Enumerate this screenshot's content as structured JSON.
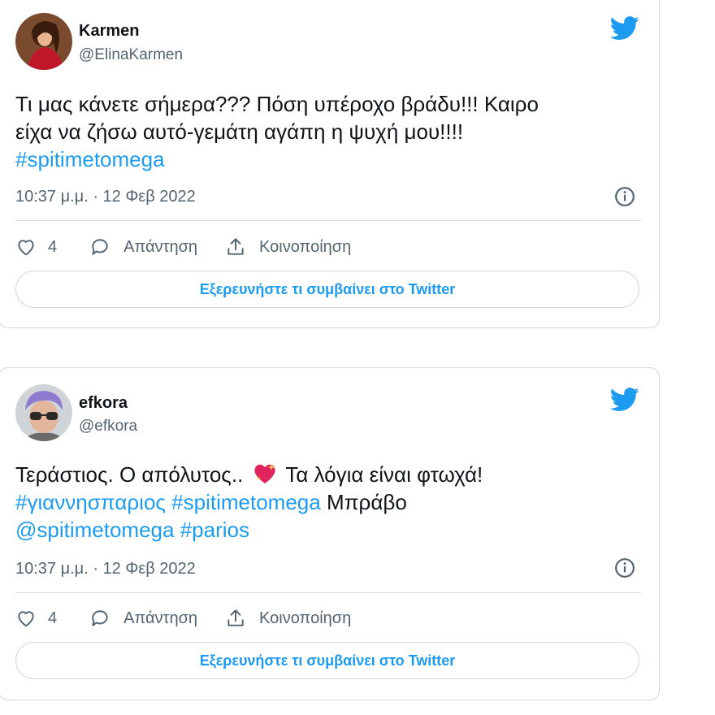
{
  "colors": {
    "accent": "#1d9bf0",
    "text": "#0f1419",
    "secondary": "#536471",
    "border": "#cfd9de"
  },
  "tweets": [
    {
      "name": "Karmen",
      "handle": "@ElinaKarmen",
      "text_line1": "Τι μας κάνετε σήμερα??? Πόση υπέροχο βράδυ!!! Καιρο",
      "text_line2": "είχα να ζήσω αυτό-γεμάτη αγάπη η ψυχή μου!!!!",
      "hashtag": "#spitimetomega",
      "timestamp": "10:37 μ.μ. · 12 Φεβ 2022",
      "likes": "4",
      "reply_label": "Απάντηση",
      "share_label": "Κοινοποίηση",
      "explore_label": "Εξερευνήστε τι συμβαίνει στο Twitter",
      "icons": [
        "avatar-photo",
        "twitter-bird-icon",
        "info-icon",
        "heart-icon",
        "reply-bubble-icon",
        "share-icon"
      ]
    },
    {
      "name": "efkora",
      "handle": "@efkora",
      "text_part1": "Τεράστιος. Ο απόλυτος..",
      "text_part2": "Τα λόγια είναι φτωχά!",
      "hashtag1": "#γιαννησπαριος",
      "hashtag2": "#spitimetomega",
      "word": "Μπράβο",
      "mention": "@spitimetomega",
      "hashtag3": "#parios",
      "emoji": "sparkling-heart-emoji",
      "timestamp": "10:37 μ.μ. · 12 Φεβ 2022",
      "likes": "4",
      "reply_label": "Απάντηση",
      "share_label": "Κοινοποίηση",
      "explore_label": "Εξερευνήστε τι συμβαίνει στο Twitter",
      "icons": [
        "avatar-photo",
        "twitter-bird-icon",
        "info-icon",
        "heart-icon",
        "reply-bubble-icon",
        "share-icon"
      ]
    }
  ]
}
